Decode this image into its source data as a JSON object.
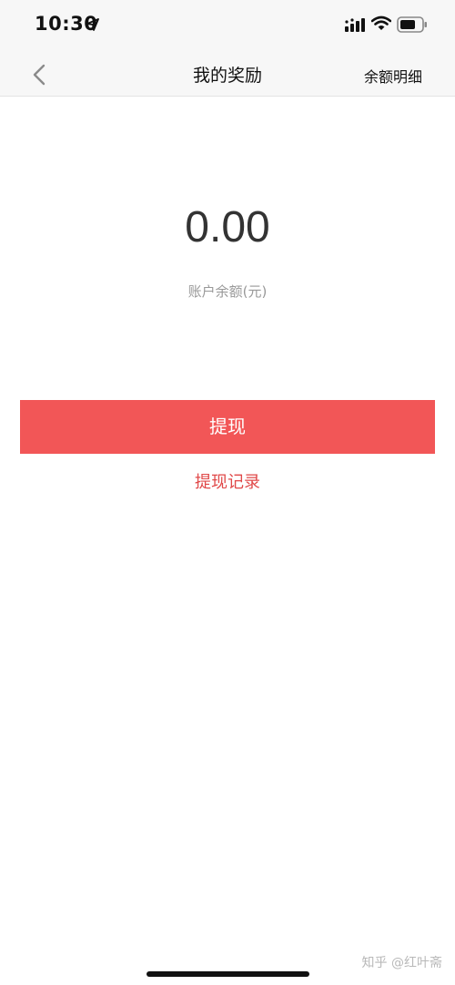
{
  "status_bar": {
    "time": "10:30"
  },
  "nav": {
    "title": "我的奖励",
    "right_label": "余额明细"
  },
  "balance": {
    "amount": "0.00",
    "label": "账户余额(元)"
  },
  "actions": {
    "withdraw_label": "提现",
    "record_label": "提现记录"
  },
  "watermark": "知乎 @红叶斋",
  "colors": {
    "accent": "#f25657",
    "link": "#e04848",
    "bar_bg": "#f7f7f7"
  },
  "icons": {
    "location": "location-arrow-icon",
    "signal": "cellular-signal-icon",
    "wifi": "wifi-icon",
    "battery": "battery-icon",
    "back": "chevron-left-icon"
  }
}
